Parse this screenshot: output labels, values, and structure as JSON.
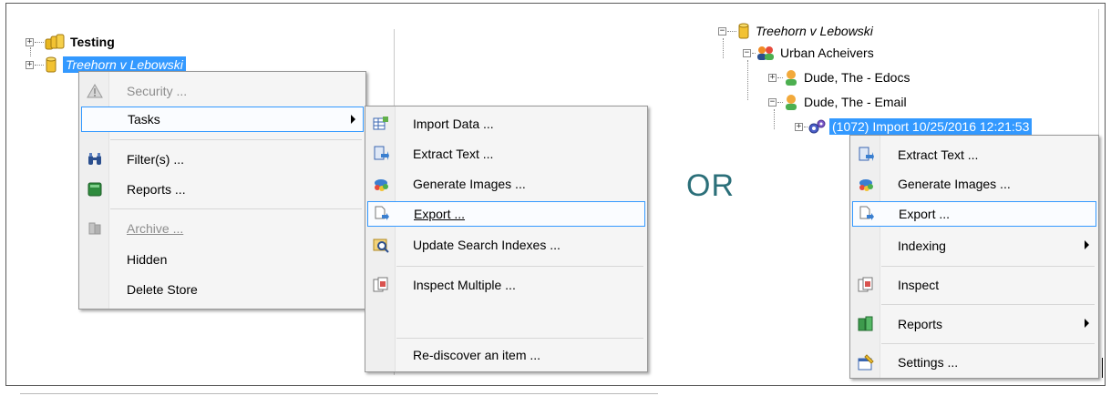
{
  "left_tree": {
    "items": [
      {
        "label": "Testing",
        "expander": "+"
      },
      {
        "label": "Treehorn v Lebowski",
        "expander": "+"
      }
    ]
  },
  "left_menu": {
    "security": "Security ...",
    "tasks": "Tasks",
    "filters": "Filter(s) ...",
    "reports": "Reports ...",
    "archive": "Archive ...",
    "hidden": "Hidden",
    "delete_store": "Delete Store"
  },
  "tasks_submenu": {
    "import_data": "Import Data ...",
    "extract_text": "Extract Text ...",
    "generate_images": "Generate Images ...",
    "export": "Export ...",
    "update_search_indexes": "Update Search Indexes ...",
    "inspect_multiple": "Inspect Multiple ...",
    "rediscover": "Re-discover an item ..."
  },
  "or_label": "OR",
  "right_tree": {
    "items": [
      {
        "label": "Treehorn v Lebowski",
        "expander": "−"
      },
      {
        "label": "Urban Acheivers",
        "expander": "−"
      },
      {
        "label": "Dude, The - Edocs",
        "expander": "+"
      },
      {
        "label": "Dude, The - Email",
        "expander": "−"
      },
      {
        "label": "(1072) Import 10/25/2016 12:21:53",
        "expander": "+"
      }
    ]
  },
  "right_menu": {
    "extract_text": "Extract Text ...",
    "generate_images": "Generate Images ...",
    "export": "Export ...",
    "indexing": "Indexing",
    "inspect": "Inspect",
    "reports": "Reports",
    "settings": "Settings ..."
  },
  "colors": {
    "selection": "#3399ff",
    "or_text": "#2b6f79",
    "menu_bg": "#f5f5f5"
  }
}
